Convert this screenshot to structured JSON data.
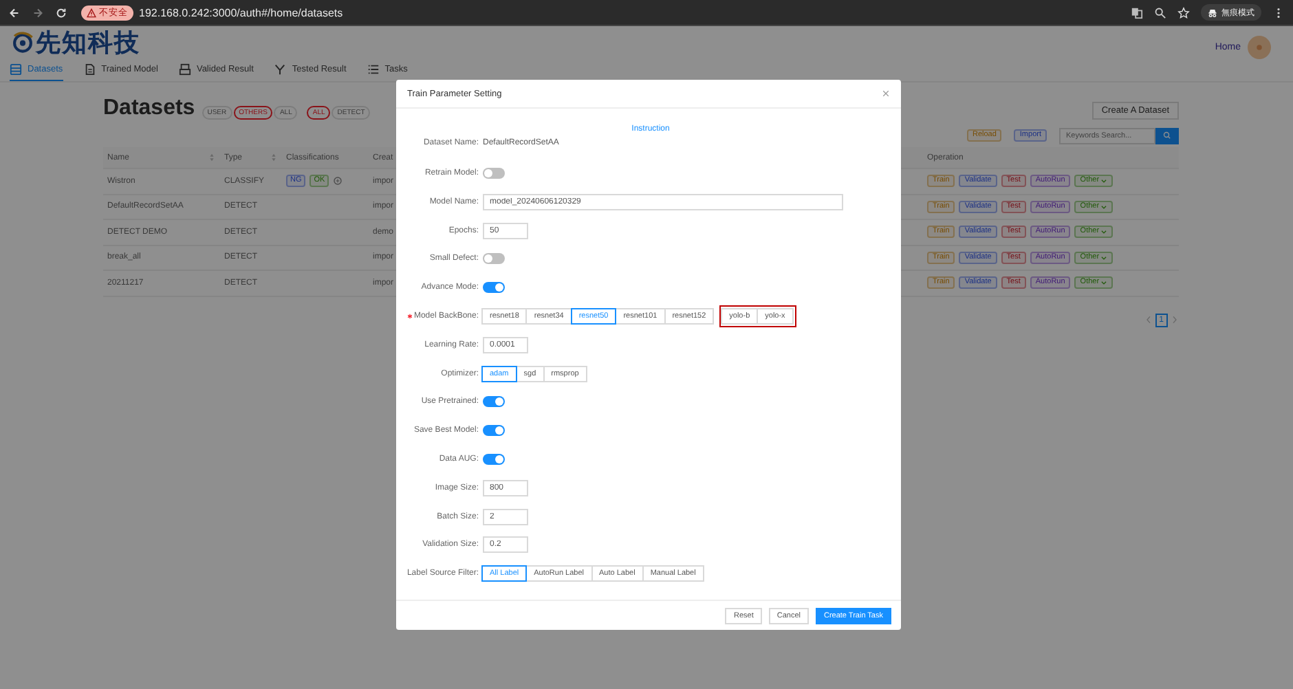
{
  "browser": {
    "security_label": "不安全",
    "url": "192.168.0.242:3000/auth#/home/datasets",
    "profile_label": "無痕模式"
  },
  "app": {
    "logo_text": "先知科技",
    "home_link": "Home",
    "nav": [
      {
        "label": "Datasets",
        "selected": true
      },
      {
        "label": "Trained Model",
        "selected": false
      },
      {
        "label": "Valided Result",
        "selected": false
      },
      {
        "label": "Tested Result",
        "selected": false
      },
      {
        "label": "Tasks",
        "selected": false
      }
    ]
  },
  "page": {
    "title": "Datasets",
    "owner_filters": [
      {
        "label": "USER",
        "selected": false
      },
      {
        "label": "OTHERS",
        "selected": true
      },
      {
        "label": "ALL",
        "selected": false
      }
    ],
    "type_filters": [
      {
        "label": "ALL",
        "selected": true
      },
      {
        "label": "DETECT",
        "selected": false
      }
    ],
    "create_button": "Create A Dataset",
    "tools": [
      {
        "label": "Reload"
      },
      {
        "label": "Import"
      }
    ],
    "search": {
      "placeholder": "Keywords Search..."
    }
  },
  "table": {
    "columns": [
      {
        "label": "Name",
        "sortable": true
      },
      {
        "label": "Type",
        "sortable": true
      },
      {
        "label": "Classifications",
        "sortable": false
      },
      {
        "label": "Creat",
        "sortable": false
      },
      {
        "label": "Operation",
        "sortable": false
      }
    ],
    "rows": [
      {
        "name": "Wistron",
        "type": "CLASSIFY",
        "classifications": [
          "NG",
          "OK"
        ],
        "created": "impor",
        "operations": [
          "Train",
          "Validate",
          "Test",
          "AutoRun",
          "Other"
        ]
      },
      {
        "name": "DefaultRecordSetAA",
        "type": "DETECT",
        "classifications": [],
        "created": "impor",
        "operations": [
          "Train",
          "Validate",
          "Test",
          "AutoRun",
          "Other"
        ]
      },
      {
        "name": "DETECT DEMO",
        "type": "DETECT",
        "classifications": [],
        "created": "demo",
        "operations": [
          "Train",
          "Validate",
          "Test",
          "AutoRun",
          "Other"
        ]
      },
      {
        "name": "break_all",
        "type": "DETECT",
        "classifications": [],
        "created": "impor",
        "operations": [
          "Train",
          "Validate",
          "Test",
          "AutoRun",
          "Other"
        ]
      },
      {
        "name": "20211217",
        "type": "DETECT",
        "classifications": [],
        "created": "impor",
        "operations": [
          "Train",
          "Validate",
          "Test",
          "AutoRun",
          "Other"
        ]
      }
    ]
  },
  "pagination": {
    "pages": [
      {
        "label": "1",
        "selected": true
      }
    ]
  },
  "dialog": {
    "title": "Train Parameter Setting",
    "instruction_link": "Instruction",
    "fields": [
      {
        "kind": "text",
        "label": "Dataset Name:",
        "value": "DefaultRecordSetAA"
      },
      {
        "kind": "switch",
        "label": "Retrain Model:",
        "on": false
      },
      {
        "kind": "text_input",
        "label": "Model Name:",
        "value": "model_20240606120329"
      },
      {
        "kind": "number_input",
        "label": "Epochs:",
        "value": "50"
      },
      {
        "kind": "switch",
        "label": "Small Defect:",
        "on": false
      },
      {
        "kind": "switch",
        "label": "Advance Mode:",
        "on": true
      },
      {
        "kind": "segmented",
        "label": "Model BackBone:",
        "required": true,
        "options": [
          {
            "label": "resnet18",
            "selected": false,
            "highlighted": false
          },
          {
            "label": "resnet34",
            "selected": false,
            "highlighted": false
          },
          {
            "label": "resnet50",
            "selected": true,
            "highlighted": false
          },
          {
            "label": "resnet101",
            "selected": false,
            "highlighted": false
          },
          {
            "label": "resnet152",
            "selected": false,
            "highlighted": false
          },
          {
            "label": "yolo-b",
            "selected": false,
            "highlighted": true
          },
          {
            "label": "yolo-x",
            "selected": false,
            "highlighted": true
          }
        ]
      },
      {
        "kind": "number_input",
        "label": "Learning Rate:",
        "value": "0.0001"
      },
      {
        "kind": "segmented",
        "label": "Optimizer:",
        "options": [
          {
            "label": "adam",
            "selected": true
          },
          {
            "label": "sgd",
            "selected": false
          },
          {
            "label": "rmsprop",
            "selected": false
          }
        ]
      },
      {
        "kind": "switch",
        "label": "Use Pretrained:",
        "on": true
      },
      {
        "kind": "switch",
        "label": "Save Best Model:",
        "on": true
      },
      {
        "kind": "switch",
        "label": "Data AUG:",
        "on": true
      },
      {
        "kind": "number_input",
        "label": "Image Size:",
        "value": "800"
      },
      {
        "kind": "number_input",
        "label": "Batch Size:",
        "value": "2"
      },
      {
        "kind": "number_input",
        "label": "Validation Size:",
        "value": "0.2"
      },
      {
        "kind": "segmented",
        "label": "Label Source Filter:",
        "options": [
          {
            "label": "All Label",
            "selected": true
          },
          {
            "label": "AutoRun Label",
            "selected": false
          },
          {
            "label": "Auto Label",
            "selected": false
          },
          {
            "label": "Manual Label",
            "selected": false
          }
        ]
      }
    ],
    "buttons": [
      {
        "label": "Reset",
        "primary": false
      },
      {
        "label": "Cancel",
        "primary": false
      },
      {
        "label": "Create Train Task",
        "primary": true
      }
    ]
  }
}
